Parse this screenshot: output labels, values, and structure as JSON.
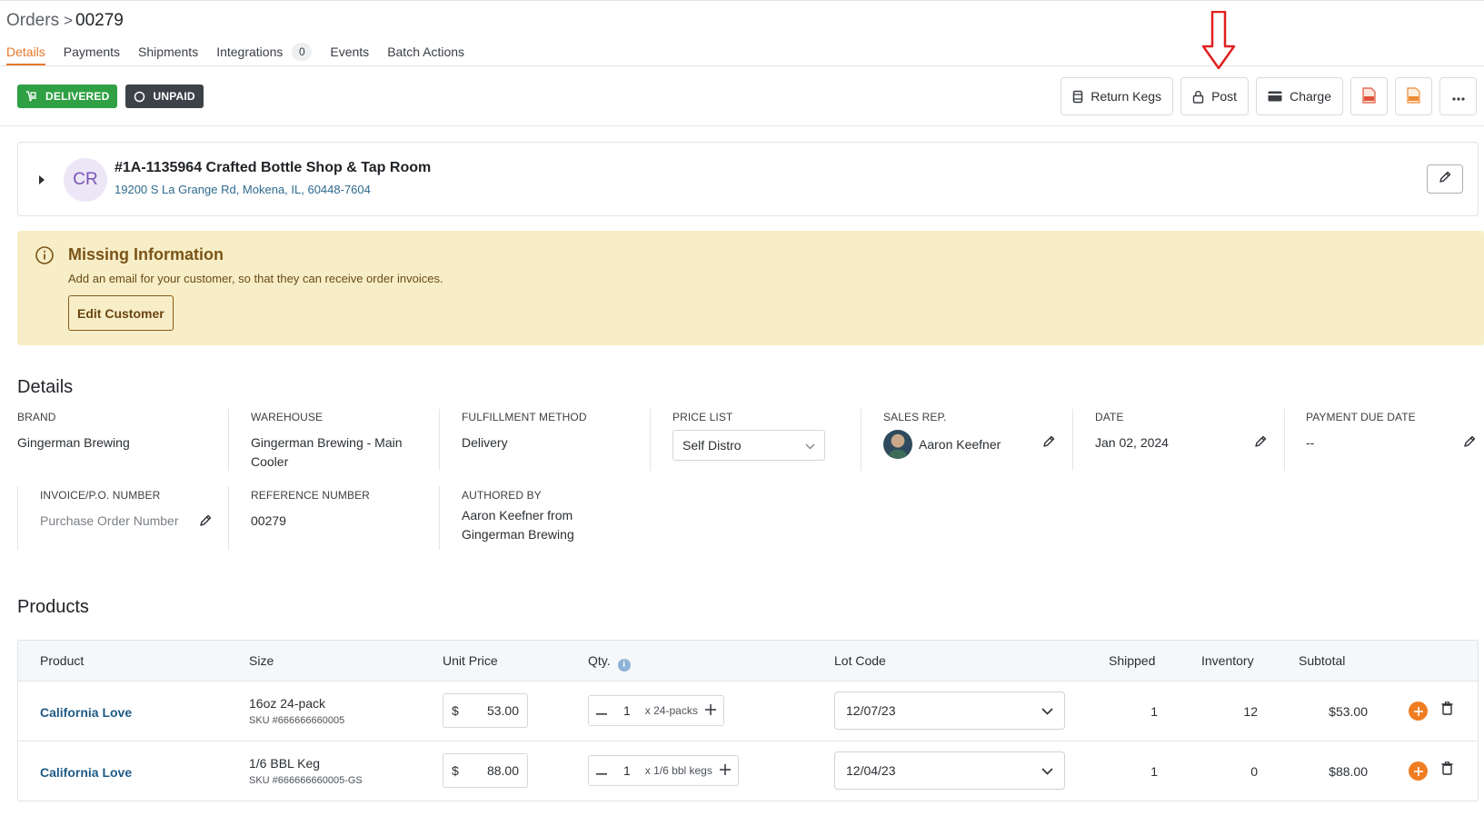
{
  "breadcrumb": {
    "parent": "Orders",
    "separator": ">",
    "current": "00279"
  },
  "tabs": [
    {
      "label": "Details",
      "active": true
    },
    {
      "label": "Payments"
    },
    {
      "label": "Shipments"
    },
    {
      "label": "Integrations",
      "badge": "0"
    },
    {
      "label": "Events"
    },
    {
      "label": "Batch Actions"
    }
  ],
  "status": {
    "delivered": "DELIVERED",
    "unpaid": "UNPAID"
  },
  "actions": {
    "return_kegs": "Return Kegs",
    "post": "Post",
    "charge": "Charge"
  },
  "colors": {
    "accent": "#e8782a",
    "delivered": "#2fa043",
    "unpaid": "#3d4248",
    "alert_bg": "#f7eec7",
    "link": "#1f5b86",
    "annotation_arrow": "#e02020"
  },
  "customer": {
    "initials": "CR",
    "name": "#1A-1135964 Crafted Bottle Shop & Tap Room",
    "address": "19200 S La Grange Rd, Mokena, IL, 60448-7604"
  },
  "alert": {
    "title": "Missing Information",
    "text": "Add an email for your customer, so that they can receive order invoices.",
    "button": "Edit Customer"
  },
  "details": {
    "title": "Details",
    "brand": {
      "label": "BRAND",
      "value": "Gingerman Brewing"
    },
    "warehouse": {
      "label": "WAREHOUSE",
      "value": "Gingerman Brewing - Main Cooler"
    },
    "fulfillment": {
      "label": "FULFILLMENT METHOD",
      "value": "Delivery"
    },
    "price_list": {
      "label": "PRICE LIST",
      "value": "Self Distro"
    },
    "sales_rep": {
      "label": "SALES REP.",
      "value": "Aaron Keefner"
    },
    "date": {
      "label": "DATE",
      "value": "Jan 02, 2024"
    },
    "payment_due": {
      "label": "PAYMENT DUE DATE",
      "value": "--"
    },
    "invoice": {
      "label": "INVOICE/P.O. NUMBER",
      "placeholder": "Purchase Order Number"
    },
    "reference": {
      "label": "REFERENCE NUMBER",
      "value": "00279"
    },
    "authored": {
      "label": "AUTHORED BY",
      "value": "Aaron Keefner from Gingerman Brewing"
    }
  },
  "products": {
    "title": "Products",
    "headers": {
      "product": "Product",
      "size": "Size",
      "unit_price": "Unit Price",
      "qty": "Qty.",
      "lot_code": "Lot Code",
      "shipped": "Shipped",
      "inventory": "Inventory",
      "subtotal": "Subtotal"
    },
    "rows": [
      {
        "name": "California Love",
        "size": "16oz 24-pack",
        "sku": "SKU #666666660005",
        "currency": "$",
        "price": "53.00",
        "qty": "1",
        "unit": "x 24-packs",
        "lot": "12/07/23",
        "shipped": "1",
        "inventory": "12",
        "subtotal": "$53.00"
      },
      {
        "name": "California Love",
        "size": "1/6 BBL Keg",
        "sku": "SKU #666666660005-GS",
        "currency": "$",
        "price": "88.00",
        "qty": "1",
        "unit": "x 1/6 bbl kegs",
        "lot": "12/04/23",
        "shipped": "1",
        "inventory": "0",
        "subtotal": "$88.00"
      }
    ]
  }
}
